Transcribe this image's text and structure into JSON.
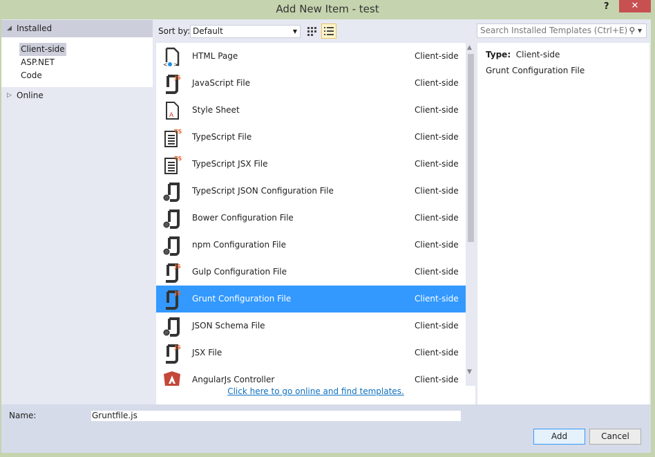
{
  "window": {
    "title": "Add New Item - test",
    "help": "?",
    "close": "✕"
  },
  "left": {
    "installed": "Installed",
    "categories": [
      "Client-side",
      "ASP.NET",
      "Code"
    ],
    "online": "Online"
  },
  "toolbar": {
    "sort_label": "Sort by:",
    "sort_value": "Default",
    "search_placeholder": "Search Installed Templates (Ctrl+E)"
  },
  "templates": [
    {
      "name": "HTML Page",
      "category": "Client-side",
      "icon": "html-file"
    },
    {
      "name": "JavaScript File",
      "category": "Client-side",
      "icon": "js-file"
    },
    {
      "name": "Style Sheet",
      "category": "Client-side",
      "icon": "css-file"
    },
    {
      "name": "TypeScript File",
      "category": "Client-side",
      "icon": "ts-file"
    },
    {
      "name": "TypeScript JSX File",
      "category": "Client-side",
      "icon": "ts-file"
    },
    {
      "name": "TypeScript JSON Configuration File",
      "category": "Client-side",
      "icon": "config-file"
    },
    {
      "name": "Bower Configuration File",
      "category": "Client-side",
      "icon": "config-file"
    },
    {
      "name": "npm Configuration File",
      "category": "Client-side",
      "icon": "config-file"
    },
    {
      "name": "Gulp Configuration File",
      "category": "Client-side",
      "icon": "js-file"
    },
    {
      "name": "Grunt Configuration File",
      "category": "Client-side",
      "icon": "js-file",
      "selected": true
    },
    {
      "name": "JSON Schema File",
      "category": "Client-side",
      "icon": "config-file"
    },
    {
      "name": "JSX File",
      "category": "Client-side",
      "icon": "js-file"
    },
    {
      "name": "AngularJs Controller",
      "category": "Client-side",
      "icon": "angular"
    }
  ],
  "online_link": "Click here to go online and find templates.",
  "details": {
    "type_label": "Type:",
    "type_value": "Client-side",
    "description": "Grunt Configuration File"
  },
  "footer": {
    "name_label": "Name:",
    "name_value": "Gruntfile.js",
    "add": "Add",
    "cancel": "Cancel"
  }
}
